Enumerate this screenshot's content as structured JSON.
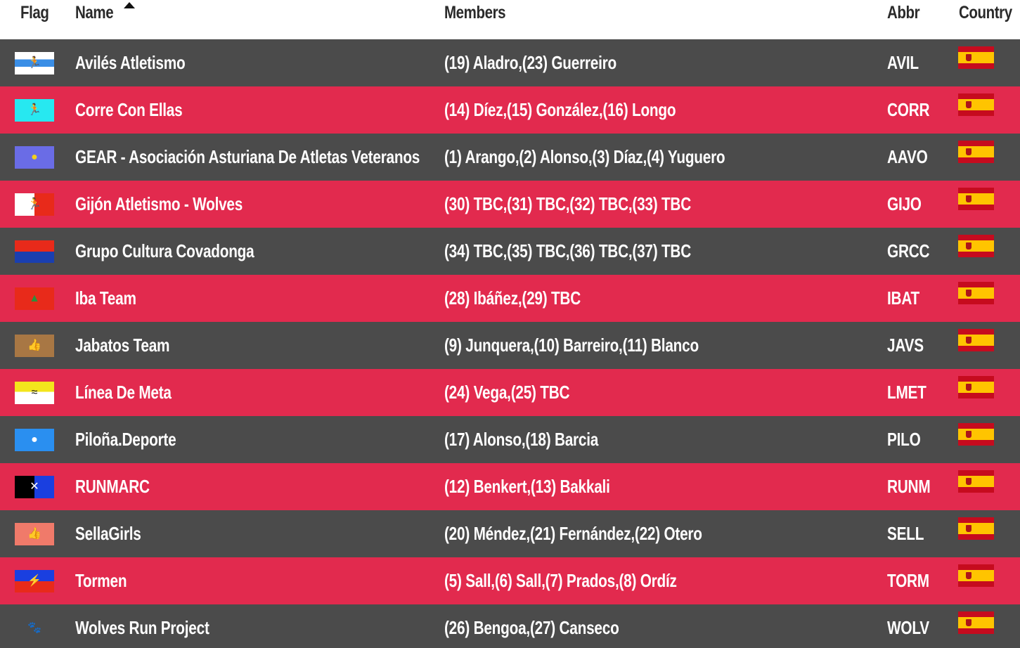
{
  "colors": {
    "row_dark": "#4b4b4b",
    "row_red": "#e22a4e",
    "text": "#ffffff",
    "header_text": "#2a2a2a"
  },
  "header": {
    "flag": "Flag",
    "name": "Name",
    "members": "Members",
    "abbr": "Abbr",
    "country": "Country",
    "sort_icon": "sort-ascending-icon"
  },
  "rows": [
    {
      "name": "Avilés Atletismo",
      "members": "(19) Aladro,(23) Guerreiro",
      "abbr": "AVIL",
      "flag_icon": "runner-icon",
      "country_icon": "spain-flag-icon"
    },
    {
      "name": "Corre Con Ellas",
      "members": "(14) Díez,(15) González,(16) Longo",
      "abbr": "CORR",
      "flag_icon": "runner-icon",
      "country_icon": "spain-flag-icon"
    },
    {
      "name": "GEAR - Asociación Asturiana De Atletas Veteranos",
      "members": "(1) Arango,(2) Alonso,(3) Díaz,(4) Yuguero",
      "abbr": "AAVO",
      "flag_icon": "star-circle-icon",
      "country_icon": "spain-flag-icon"
    },
    {
      "name": "Gijón Atletismo - Wolves",
      "members": "(30) TBC,(31) TBC,(32) TBC,(33) TBC",
      "abbr": "GIJO",
      "flag_icon": "runner-icon",
      "country_icon": "spain-flag-icon"
    },
    {
      "name": "Grupo Cultura Covadonga",
      "members": "(34) TBC,(35) TBC,(36) TBC,(37) TBC",
      "abbr": "GRCC",
      "flag_icon": "stripes-icon",
      "country_icon": "spain-flag-icon"
    },
    {
      "name": "Iba Team",
      "members": "(28) Ibáñez,(29) TBC",
      "abbr": "IBAT",
      "flag_icon": "mountain-icon",
      "country_icon": "spain-flag-icon"
    },
    {
      "name": "Jabatos Team",
      "members": "(9) Junquera,(10) Barreiro,(11) Blanco",
      "abbr": "JAVS",
      "flag_icon": "thumbs-up-icon",
      "country_icon": "spain-flag-icon"
    },
    {
      "name": "Línea De Meta",
      "members": "(24) Vega,(25) TBC",
      "abbr": "LMET",
      "flag_icon": "swimmer-icon",
      "country_icon": "spain-flag-icon"
    },
    {
      "name": "Piloña.Deporte",
      "members": "(17) Alonso,(18) Barcia",
      "abbr": "PILO",
      "flag_icon": "circle-icon",
      "country_icon": "spain-flag-icon"
    },
    {
      "name": "RUNMARC",
      "members": "(12) Benkert,(13) Bakkali",
      "abbr": "RUNM",
      "flag_icon": "cross-icon",
      "country_icon": "spain-flag-icon"
    },
    {
      "name": "SellaGirls",
      "members": "(20) Méndez,(21) Fernández,(22) Otero",
      "abbr": "SELL",
      "flag_icon": "thumbs-up-icon",
      "country_icon": "spain-flag-icon"
    },
    {
      "name": "Tormen",
      "members": "(5) Sall,(6) Sall,(7) Prados,(8) Ordíz",
      "abbr": "TORM",
      "flag_icon": "lightning-icon",
      "country_icon": "spain-flag-icon"
    },
    {
      "name": "Wolves Run Project",
      "members": "(26) Bengoa,(27) Canseco",
      "abbr": "WOLV",
      "flag_icon": "paw-icon",
      "country_icon": "spain-flag-icon"
    }
  ]
}
